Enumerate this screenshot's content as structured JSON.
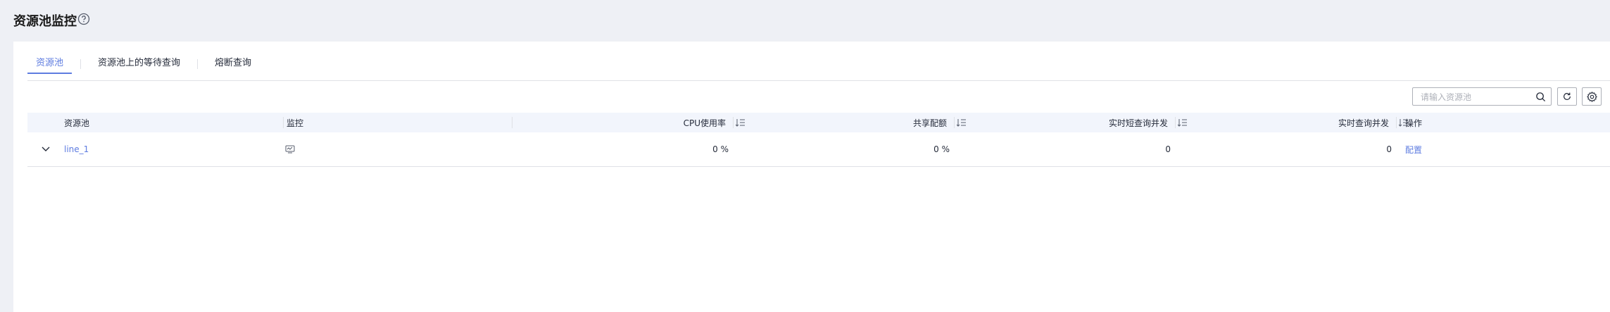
{
  "page": {
    "title": "资源池监控"
  },
  "tabs": [
    {
      "label": "资源池",
      "active": true
    },
    {
      "label": "资源池上的等待查询",
      "active": false
    },
    {
      "label": "熔断查询",
      "active": false
    }
  ],
  "toolbar": {
    "search_placeholder": "请输入资源池"
  },
  "table": {
    "columns": [
      "资源池",
      "监控",
      "CPU使用率",
      "共享配额",
      "实时短查询并发",
      "实时查询并发",
      "操作"
    ],
    "rows": [
      {
        "name": "line_1",
        "cpu": "0 %",
        "quota": "0 %",
        "short_concurrency": "0",
        "concurrency": "0",
        "action": "配置"
      }
    ]
  },
  "colors": {
    "accent": "#5e7ce0",
    "header_bg": "#f2f5fc",
    "border": "#dfe1e6"
  }
}
